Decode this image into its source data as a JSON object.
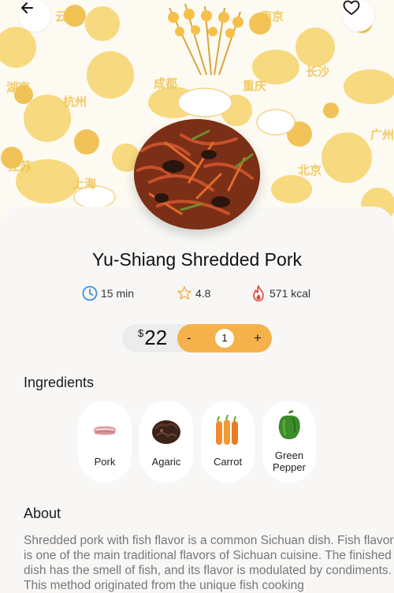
{
  "header": {
    "back_icon": "arrow-left-icon",
    "favorite_icon": "heart-outline-icon",
    "background_city_labels": [
      "云南",
      "成都",
      "杭州",
      "上海",
      "北京",
      "长沙",
      "重庆",
      "广州",
      "湖南",
      "南京",
      "江苏"
    ]
  },
  "dish": {
    "name": "Yu-Shiang Shredded Pork",
    "image": "yu-shiang-shredded-pork-photo"
  },
  "meta": {
    "time": "15 min",
    "time_icon": "clock-icon",
    "rating": "4.8",
    "rating_icon": "star-outline-icon",
    "calories": "571 kcal",
    "calories_icon": "flame-icon"
  },
  "price": {
    "currency": "$",
    "amount": "22",
    "quantity": "1",
    "minus_label": "-",
    "plus_label": "+"
  },
  "ingredients": {
    "title": "Ingredients",
    "items": [
      {
        "label": "Pork",
        "icon": "pork-icon"
      },
      {
        "label": "Agaric",
        "icon": "agaric-icon"
      },
      {
        "label": "Carrot",
        "icon": "carrot-icon"
      },
      {
        "label": "Green Pepper",
        "icon": "green-pepper-icon"
      }
    ]
  },
  "about": {
    "title": "About",
    "text": "Shredded pork with fish flavor is a common Sichuan dish. Fish flavor is one of the main traditional flavors of Sichuan cuisine. The finished dish has the smell of fish, and its flavor is modulated by condiments. This method originated from the unique fish cooking"
  },
  "colors": {
    "accent": "#f5b14a",
    "background": "#f8f7f5",
    "clock": "#3a8fe0",
    "star": "#f5b14a",
    "flame": "#e0443a"
  }
}
